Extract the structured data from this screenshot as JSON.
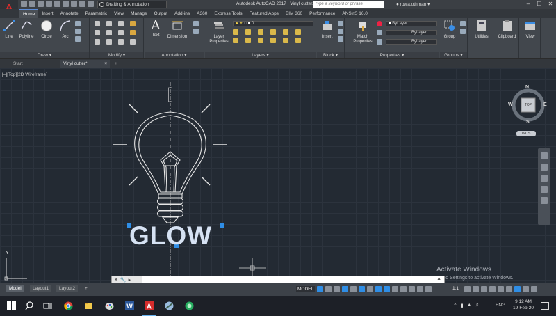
{
  "window": {
    "app_title": "Autodesk AutoCAD 2017",
    "file_name": "Vinyl cutter.dwg",
    "workspace": "Drafting & Annotation",
    "search_placeholder": "Type a keyword or phrase",
    "user": "rowa.othman",
    "logo_letter": "A"
  },
  "ribbon_tabs": [
    "Home",
    "Insert",
    "Annotate",
    "Parametric",
    "View",
    "Manage",
    "Output",
    "Add-ins",
    "A360",
    "Express Tools",
    "Featured Apps",
    "BIM 360",
    "Performance",
    "ANSYS 16.0"
  ],
  "ribbon": {
    "draw": {
      "title": "Draw",
      "line": "Line",
      "polyline": "Polyline",
      "circle": "Circle",
      "arc": "Arc"
    },
    "modify": {
      "title": "Modify"
    },
    "annotation": {
      "title": "Annotation",
      "text": "Text",
      "dimension": "Dimension"
    },
    "layers": {
      "title": "Layers",
      "layer_properties": "Layer Properties",
      "current_layer": "0"
    },
    "block": {
      "title": "Block",
      "insert": "Insert"
    },
    "properties": {
      "title": "Properties",
      "match": "Match Properties",
      "color": "ByLayer",
      "linetype": "ByLayer",
      "lineweight": "ByLayer"
    },
    "groups": {
      "title": "Groups",
      "group": "Group"
    },
    "utilities": "Utilities",
    "clipboard": "Clipboard",
    "view": "View"
  },
  "file_tabs": {
    "start": "Start",
    "active": "Vinyl cutter*"
  },
  "viewport": {
    "label": "[–][Top][2D Wireframe]",
    "drawing_text": "GLOW",
    "viewcube": {
      "north": "N",
      "south": "S",
      "east": "E",
      "west": "W",
      "face": "TOP",
      "ucs": "WCS"
    },
    "ucs_y": "Y",
    "activation_title": "Activate Windows",
    "activation_sub": "Go to Settings to activate Windows."
  },
  "command_line": {
    "placeholder": ""
  },
  "layout_tabs": [
    "Model",
    "Layout1",
    "Layout2"
  ],
  "status_bar": {
    "model_label": "MODEL",
    "scale": "1:1"
  },
  "taskbar": {
    "language": "ENG",
    "time": "9:12 AM",
    "date": "19-Feb-20"
  },
  "colors": {
    "accent": "#2f8ee6",
    "autocad_red": "#d52c2c",
    "grip_blue": "#2f8ee6"
  }
}
